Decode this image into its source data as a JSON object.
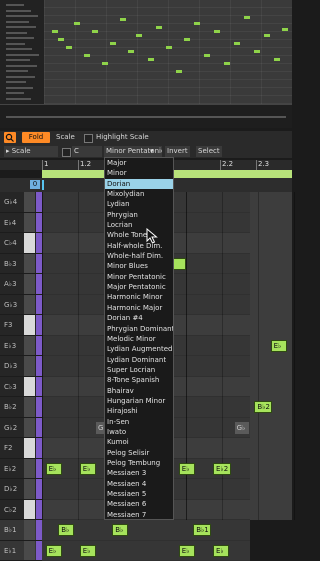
{
  "toolbar": {
    "fold_label": "Fold",
    "scale_label": "Scale",
    "highlight_scale_label": "Highlight Scale",
    "scale_dropdown_label": "▸ Scale",
    "root_note_value": "C",
    "scale_name_value": "Minor Pentatonic",
    "invert_label": "Invert",
    "select_label": "Select"
  },
  "ruler": {
    "labels": [
      "1",
      "1.2",
      "2",
      "2.2",
      "2.3"
    ]
  },
  "markers": {
    "start": "0"
  },
  "scale_menu": {
    "selected": "Dorian",
    "items": [
      "Major",
      "Minor",
      "Dorian",
      "Mixolydian",
      "Lydian",
      "Phrygian",
      "Locrian",
      "Whole Tone",
      "Half-whole Dim.",
      "Whole-half Dim.",
      "Minor Blues",
      "Minor Pentatonic",
      "Major Pentatonic",
      "Harmonic Minor",
      "Harmonic Major",
      "Dorian #4",
      "Phrygian Dominant",
      "Melodic Minor",
      "Lydian Augmented",
      "Lydian Dominant",
      "Super Locrian",
      "8-Tone Spanish",
      "Bhairav",
      "Hungarian Minor",
      "Hirajoshi",
      "In-Sen",
      "Iwato",
      "Kumoi",
      "Pelog Selisir",
      "Pelog Tembung",
      "Messiaen 3",
      "Messiaen 4",
      "Messiaen 5",
      "Messiaen 6",
      "Messiaen 7"
    ]
  },
  "piano_keys": [
    {
      "label": "G♭4",
      "white": false
    },
    {
      "label": "E♭4",
      "white": false
    },
    {
      "label": "C♭4",
      "white": true
    },
    {
      "label": "B♭3",
      "white": false
    },
    {
      "label": "A♭3",
      "white": false
    },
    {
      "label": "G♭3",
      "white": false
    },
    {
      "label": "F3",
      "white": true
    },
    {
      "label": "E♭3",
      "white": false
    },
    {
      "label": "D♭3",
      "white": false
    },
    {
      "label": "C♭3",
      "white": true
    },
    {
      "label": "B♭2",
      "white": false
    },
    {
      "label": "G♭2",
      "white": false
    },
    {
      "label": "F2",
      "white": true
    },
    {
      "label": "E♭2",
      "white": false
    },
    {
      "label": "D♭2",
      "white": false
    },
    {
      "label": "C♭2",
      "white": true
    },
    {
      "label": "B♭1",
      "white": false
    },
    {
      "label": "E♭1",
      "white": false
    }
  ],
  "notes": [
    {
      "label": "E♭",
      "row": 13,
      "beat": 0.1
    },
    {
      "label": "E♭",
      "row": 13,
      "beat": 1.05
    },
    {
      "label": "E♭",
      "row": 13,
      "beat": 3.8
    },
    {
      "label": "E♭2",
      "row": 13,
      "beat": 4.75
    },
    {
      "label": "B♭",
      "row": 16,
      "beat": 0.45
    },
    {
      "label": "B♭",
      "row": 16,
      "beat": 1.95
    },
    {
      "label": "B♭1",
      "row": 16,
      "beat": 4.2
    },
    {
      "label": "E♭",
      "row": 17,
      "beat": 0.1
    },
    {
      "label": "E♭",
      "row": 17,
      "beat": 1.05
    },
    {
      "label": "E♭",
      "row": 17,
      "beat": 3.8
    },
    {
      "label": "E♭",
      "row": 17,
      "beat": 4.75
    },
    {
      "label": "B♭2",
      "row": 10,
      "beat": 5.9
    },
    {
      "label": "E♭",
      "row": 7,
      "beat": 6.35
    },
    {
      "label": "",
      "row": 3,
      "beat": 3.55
    }
  ],
  "ghost_notes": [
    {
      "label": "G",
      "row": 11,
      "beat": 1.5
    },
    {
      "label": "G♭",
      "row": 11,
      "beat": 5.35
    }
  ]
}
